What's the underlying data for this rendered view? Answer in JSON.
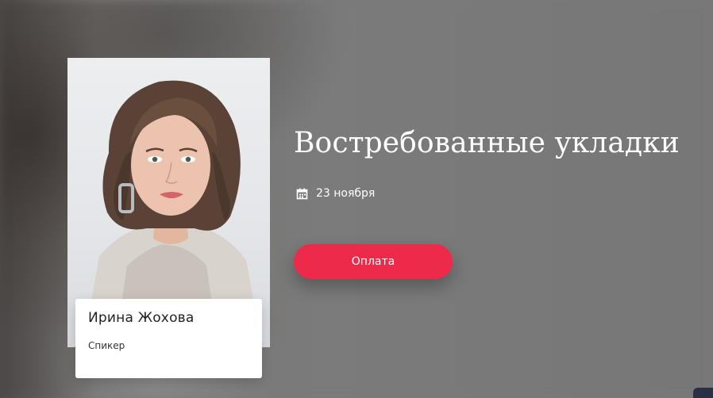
{
  "event": {
    "title": "Востребованные укладки",
    "date": "23 ноября",
    "pay_button_label": "Оплата"
  },
  "speaker": {
    "name": "Ирина Жохова",
    "role": "Спикер"
  },
  "icons": {
    "date_icon": "calendar-icon",
    "corner_widget": "chat-widget"
  },
  "colors": {
    "accent": "#ee2a4a",
    "title_text": "#ffffff",
    "background": "#7a7a7a"
  }
}
